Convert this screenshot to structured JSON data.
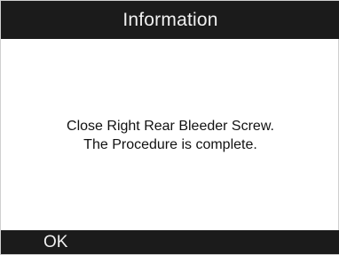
{
  "header": {
    "title": "Information"
  },
  "message": {
    "lines": [
      "Close Right Rear Bleeder Screw.",
      "The Procedure is complete."
    ]
  },
  "footer": {
    "ok_label": "OK"
  },
  "colors": {
    "bar_background": "#1b1b1b",
    "bar_text": "#f0f0f0",
    "body_background": "#ffffff",
    "body_text": "#111111"
  }
}
